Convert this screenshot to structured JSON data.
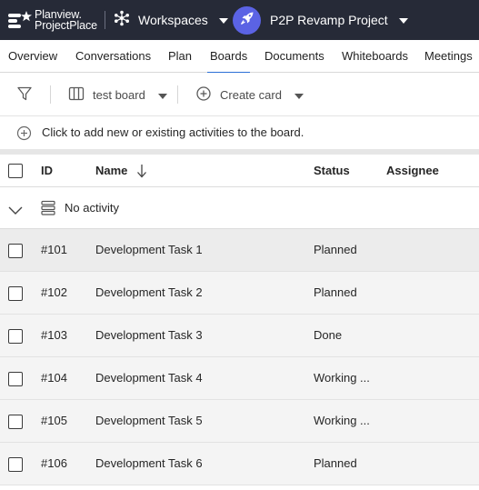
{
  "header": {
    "logo_line1": "Planview.",
    "logo_line2": "ProjectPlace",
    "workspaces_label": "Workspaces",
    "project_label": "P2P Revamp Project"
  },
  "tabs": [
    {
      "label": "Overview",
      "active": false
    },
    {
      "label": "Conversations",
      "active": false
    },
    {
      "label": "Plan",
      "active": false
    },
    {
      "label": "Boards",
      "active": true
    },
    {
      "label": "Documents",
      "active": false
    },
    {
      "label": "Whiteboards",
      "active": false
    },
    {
      "label": "Meetings",
      "active": false
    }
  ],
  "toolbar": {
    "board_label": "test board",
    "create_card_label": "Create card"
  },
  "add_row": {
    "text": "Click to add new or existing activities to the board."
  },
  "table": {
    "headers": {
      "id": "ID",
      "name": "Name",
      "status": "Status",
      "assignee": "Assignee"
    },
    "sort": {
      "column": "Name",
      "direction": "descending"
    },
    "group_label": "No activity",
    "rows": [
      {
        "id": "#101",
        "name": "Development Task 1",
        "status": "Planned",
        "assignee": ""
      },
      {
        "id": "#102",
        "name": "Development Task 2",
        "status": "Planned",
        "assignee": ""
      },
      {
        "id": "#103",
        "name": "Development Task 3",
        "status": "Done",
        "assignee": ""
      },
      {
        "id": "#104",
        "name": "Development Task 4",
        "status": "Working ...",
        "assignee": ""
      },
      {
        "id": "#105",
        "name": "Development Task 5",
        "status": "Working ...",
        "assignee": ""
      },
      {
        "id": "#106",
        "name": "Development Task 6",
        "status": "Planned",
        "assignee": ""
      }
    ]
  },
  "colors": {
    "topbar": "#262a37",
    "active_tab_underline": "#2b6fd6",
    "project_avatar": "#5b63e4",
    "row_background": "#f4f4f4"
  },
  "icons": {
    "logo": "planview-logo-icon",
    "workspaces": "workspaces-network-icon",
    "project": "rocket-icon",
    "filter": "filter-icon",
    "board_view": "board-columns-icon",
    "create": "plus-circle-icon",
    "group": "stack-icon",
    "sort": "arrow-down-icon"
  }
}
